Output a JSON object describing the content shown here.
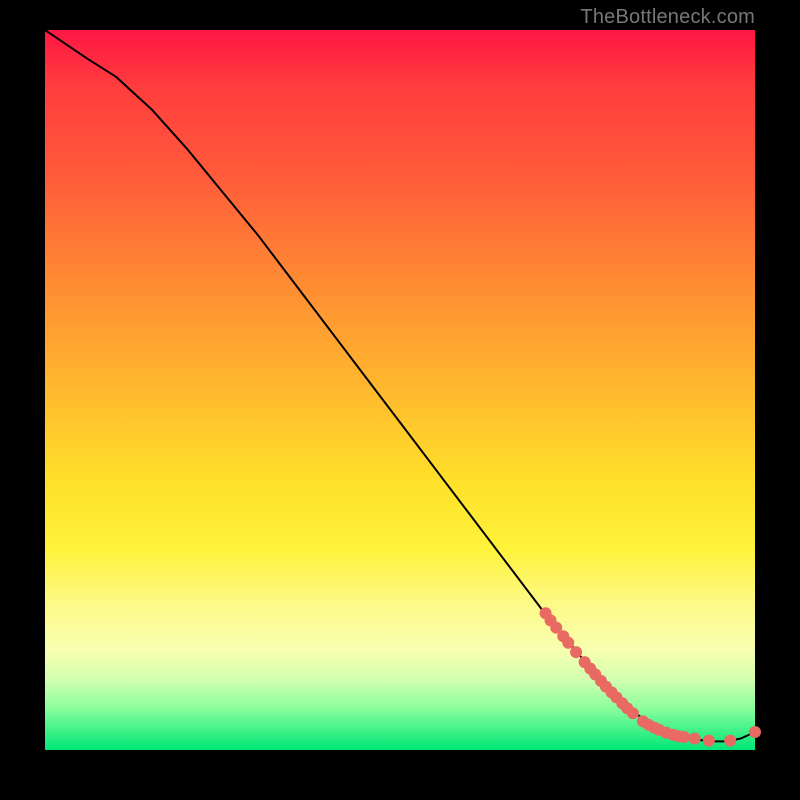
{
  "watermark": "TheBottleneck.com",
  "chart_data": {
    "type": "line",
    "title": "",
    "xlabel": "",
    "ylabel": "",
    "xlim": [
      0,
      100
    ],
    "ylim": [
      0,
      100
    ],
    "grid": false,
    "series": [
      {
        "name": "curve",
        "color": "#000000",
        "x": [
          0,
          3,
          6,
          10,
          15,
          20,
          25,
          30,
          35,
          40,
          45,
          50,
          55,
          60,
          65,
          70,
          75,
          78,
          80,
          82,
          84,
          86,
          88,
          90,
          92,
          94,
          96,
          98,
          100
        ],
        "y": [
          100,
          98,
          96,
          93.5,
          89,
          83.5,
          77.5,
          71.5,
          65,
          58.5,
          52,
          45.5,
          39,
          32.5,
          26,
          19.5,
          13.5,
          10,
          8,
          6,
          4.5,
          3.2,
          2.4,
          1.8,
          1.4,
          1.2,
          1.2,
          1.6,
          2.5
        ]
      }
    ],
    "markers": [
      {
        "x": 70.5,
        "y": 19.0,
        "r": 6
      },
      {
        "x": 71.2,
        "y": 18.0,
        "r": 6
      },
      {
        "x": 72.0,
        "y": 17.0,
        "r": 6
      },
      {
        "x": 73.0,
        "y": 15.8,
        "r": 6
      },
      {
        "x": 73.7,
        "y": 14.9,
        "r": 6
      },
      {
        "x": 74.8,
        "y": 13.6,
        "r": 6
      },
      {
        "x": 76.0,
        "y": 12.2,
        "r": 6
      },
      {
        "x": 76.8,
        "y": 11.3,
        "r": 6
      },
      {
        "x": 77.5,
        "y": 10.5,
        "r": 6
      },
      {
        "x": 78.3,
        "y": 9.6,
        "r": 6
      },
      {
        "x": 79.0,
        "y": 8.8,
        "r": 6
      },
      {
        "x": 79.8,
        "y": 8.0,
        "r": 6
      },
      {
        "x": 80.5,
        "y": 7.3,
        "r": 6
      },
      {
        "x": 81.3,
        "y": 6.5,
        "r": 6
      },
      {
        "x": 82.0,
        "y": 5.8,
        "r": 6
      },
      {
        "x": 82.8,
        "y": 5.1,
        "r": 6
      },
      {
        "x": 84.2,
        "y": 4.0,
        "r": 6
      },
      {
        "x": 85.0,
        "y": 3.5,
        "r": 6
      },
      {
        "x": 85.8,
        "y": 3.1,
        "r": 6
      },
      {
        "x": 86.5,
        "y": 2.8,
        "r": 6
      },
      {
        "x": 87.5,
        "y": 2.4,
        "r": 6
      },
      {
        "x": 88.5,
        "y": 2.1,
        "r": 6
      },
      {
        "x": 89.3,
        "y": 1.9,
        "r": 6
      },
      {
        "x": 90.0,
        "y": 1.8,
        "r": 6
      },
      {
        "x": 91.5,
        "y": 1.6,
        "r": 6
      },
      {
        "x": 93.5,
        "y": 1.3,
        "r": 6
      },
      {
        "x": 96.5,
        "y": 1.3,
        "r": 6
      },
      {
        "x": 100.0,
        "y": 2.5,
        "r": 6
      }
    ],
    "marker_color": "#e86a63",
    "gradient_stops": [
      {
        "pos": 0,
        "color": "#ff1744"
      },
      {
        "pos": 8,
        "color": "#ff3d3d"
      },
      {
        "pos": 20,
        "color": "#ff5a3a"
      },
      {
        "pos": 35,
        "color": "#ff8b33"
      },
      {
        "pos": 50,
        "color": "#ffb92e"
      },
      {
        "pos": 63,
        "color": "#ffe12a"
      },
      {
        "pos": 72,
        "color": "#fff23a"
      },
      {
        "pos": 80,
        "color": "#fdfa8a"
      },
      {
        "pos": 86,
        "color": "#f8ffb0"
      },
      {
        "pos": 90,
        "color": "#d5ffb0"
      },
      {
        "pos": 94,
        "color": "#8fff9e"
      },
      {
        "pos": 100,
        "color": "#00e676"
      }
    ]
  }
}
